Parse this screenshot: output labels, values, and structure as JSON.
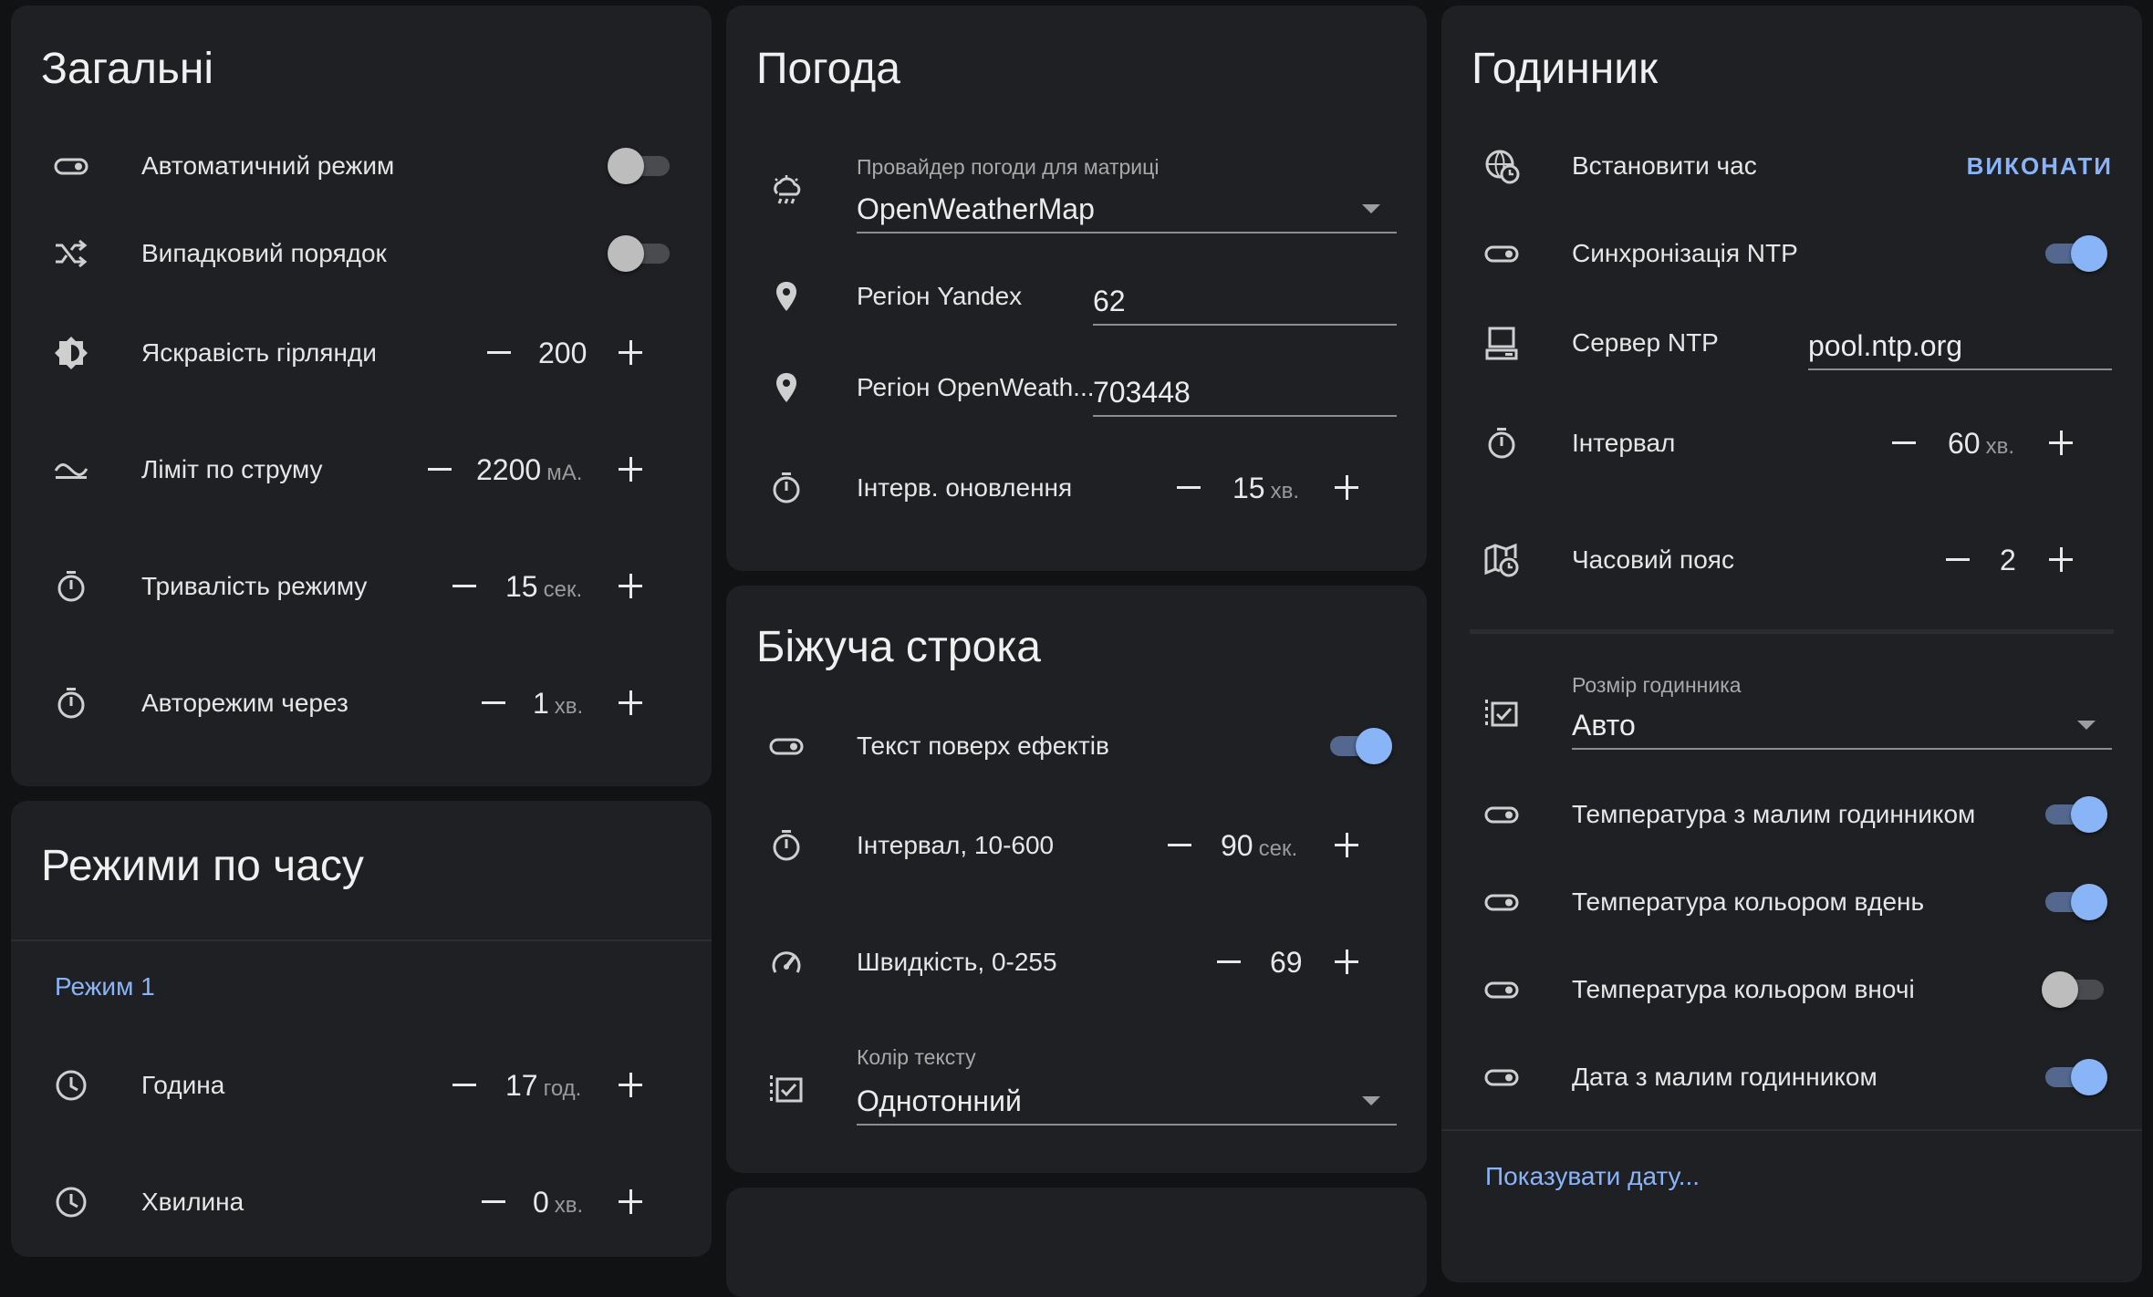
{
  "general": {
    "title": "Загальні",
    "auto_mode": "Автоматичний режим",
    "random_order": "Випадковий порядок",
    "brightness": {
      "label": "Яскравість гірлянди",
      "value": "200"
    },
    "current_limit": {
      "label": "Ліміт по струму",
      "value": "2200",
      "unit": "мА."
    },
    "mode_duration": {
      "label": "Тривалість режиму",
      "value": "15",
      "unit": "сек."
    },
    "automode_after": {
      "label": "Авторежим через",
      "value": "1",
      "unit": "хв."
    }
  },
  "time_modes": {
    "title": "Режими по часу",
    "mode_link": "Режим 1",
    "hour": {
      "label": "Година",
      "value": "17",
      "unit": "год."
    },
    "minute": {
      "label": "Хвилина",
      "value": "0",
      "unit": "хв."
    }
  },
  "weather": {
    "title": "Погода",
    "provider": {
      "caption": "Провайдер погоди для матриці",
      "value": "OpenWeatherMap"
    },
    "region_yandex": {
      "label": "Регіон Yandex",
      "value": "62"
    },
    "region_owm": {
      "label": "Регіон OpenWeath...",
      "value": "703448"
    },
    "update_interval": {
      "label": "Інтерв. оновлення",
      "value": "15",
      "unit": "хв."
    }
  },
  "ticker": {
    "title": "Біжуча строка",
    "text_over": "Текст поверх ефектів",
    "interval": {
      "label": "Інтервал, 10-600",
      "value": "90",
      "unit": "сек."
    },
    "speed": {
      "label": "Швидкість, 0-255",
      "value": "69"
    },
    "text_color": {
      "caption": "Колір тексту",
      "value": "Однотонний"
    }
  },
  "clock": {
    "title": "Годинник",
    "set_time": {
      "label": "Встановити час",
      "action": "ВИКОНАТИ"
    },
    "ntp_sync": "Синхронізація NTP",
    "ntp_server": {
      "label": "Сервер NTP",
      "value": "pool.ntp.org"
    },
    "interval": {
      "label": "Інтервал",
      "value": "60",
      "unit": "хв."
    },
    "timezone": {
      "label": "Часовий пояс",
      "value": "2"
    },
    "clock_size": {
      "caption": "Розмір годинника",
      "value": "Авто"
    },
    "temp_small_clock": "Температура з малим годинником",
    "temp_color_day": "Температура кольором вдень",
    "temp_color_night": "Температура кольором вночі",
    "date_small_clock": "Дата з малим годинником",
    "show_date_link": "Показувати дату..."
  },
  "toggles": {
    "auto_mode": false,
    "random_order": false,
    "text_over": true,
    "ntp_sync": true,
    "temp_small_clock": true,
    "temp_color_day": true,
    "temp_color_night": false,
    "date_small_clock": true
  },
  "colors": {
    "accent": "#8ab4f8",
    "card": "#1f2023",
    "background": "#111214"
  },
  "icons": [
    "toggle-icon",
    "shuffle-icon",
    "brightness-icon",
    "current-icon",
    "timer-icon",
    "weather-cloud-icon",
    "location-pin-icon",
    "clock-icon",
    "globe-clock-icon",
    "computer-icon",
    "map-clock-icon",
    "checklist-icon",
    "speedometer-icon"
  ]
}
